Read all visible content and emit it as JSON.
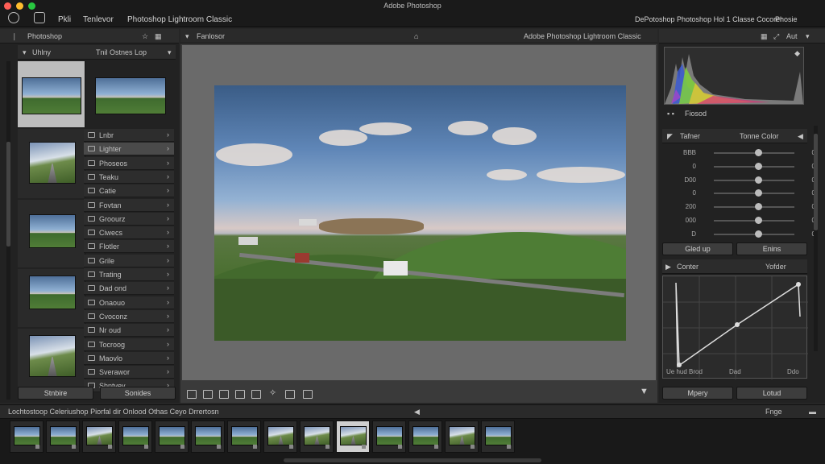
{
  "titlebar": {
    "title": "Adobe Photoshop",
    "menu": [
      "Pkli",
      "Tenlevor",
      "Photoshop Lightroom Classic"
    ],
    "right_text": "DePotoshop Photoshop Hol 1 Classe Cocorer",
    "right_menu": "Phosie"
  },
  "left_panel": {
    "header": "Photoshop",
    "subheader": "Uhlny",
    "subheader_right": "Tnil Ostnes Lop",
    "items": [
      {
        "label": "Lnbr"
      },
      {
        "label": "Lighter",
        "selected": true
      },
      {
        "label": "Phoseos"
      },
      {
        "label": "Teaku"
      },
      {
        "label": "Catie"
      },
      {
        "label": "Fovtan"
      },
      {
        "label": "Groourz"
      },
      {
        "label": "Ciwecs"
      },
      {
        "label": "Flotler"
      },
      {
        "label": "Grile"
      },
      {
        "label": "Trating"
      },
      {
        "label": "Dad ond"
      },
      {
        "label": "Onaouo"
      },
      {
        "label": "Cvoconz"
      },
      {
        "label": "Nr oud"
      },
      {
        "label": "Tocroog"
      },
      {
        "label": "Maovlo"
      },
      {
        "label": "Sverawor"
      },
      {
        "label": "Shntvey"
      }
    ],
    "buttons": [
      "Stnbire",
      "Sonides"
    ]
  },
  "center": {
    "header_left": "Fanlosor",
    "header_center": "Adobe Photoshop Lightroom Classic"
  },
  "right_panel": {
    "histogram_label": "Fiosod",
    "basic_title": "Tafner",
    "basic_right": "Tonne Color",
    "sliders": [
      {
        "label": "BBB",
        "value": "0",
        "pos": 0.55
      },
      {
        "label": "0",
        "value": "0",
        "pos": 0.55
      },
      {
        "label": "D00",
        "value": "0",
        "pos": 0.55
      },
      {
        "label": "0",
        "value": "0",
        "pos": 0.55
      },
      {
        "label": "200",
        "value": "0",
        "pos": 0.55
      },
      {
        "label": "000",
        "value": "0",
        "pos": 0.55
      },
      {
        "label": "D",
        "value": "0",
        "pos": 0.55
      }
    ],
    "buttons_mid": [
      "Gled up",
      "Enins"
    ],
    "curve_title": "Conter",
    "curve_right": "Yofder",
    "curve_labels": [
      "Ue hud Brod",
      "Dad",
      "Ddo"
    ],
    "buttons_bottom": [
      "Mpery",
      "Lotud"
    ]
  },
  "filmbar": {
    "text": "Lochtostoop Celeriushop Piorfal dir Onlood Othas Ceyo Drrertosn",
    "right": "Fnge"
  }
}
